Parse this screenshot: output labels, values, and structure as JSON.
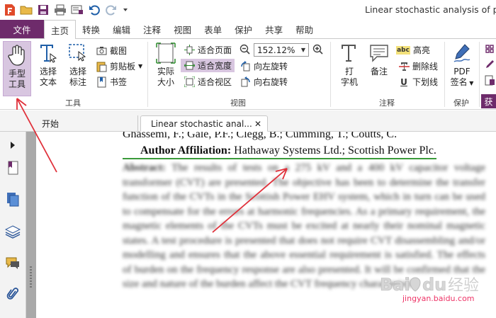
{
  "window": {
    "title": "Linear stochastic analysis of po"
  },
  "ribbon_tabs": [
    "文件",
    "主页",
    "转换",
    "编辑",
    "注释",
    "视图",
    "表单",
    "保护",
    "共享",
    "帮助"
  ],
  "ribbon": {
    "hand_tool": {
      "line1": "手型",
      "line2": "工具"
    },
    "select_text": {
      "line1": "选择",
      "line2": "文本"
    },
    "select_annot": {
      "line1": "选择",
      "line2": "标注"
    },
    "screenshot": "截图",
    "clipboard": "剪贴板",
    "bookmark": "书签",
    "group_tools": "工具",
    "actual_size": {
      "line1": "实际",
      "line2": "大小"
    },
    "fit_page": "适合页面",
    "fit_width": "适合宽度",
    "fit_visible": "适合视区",
    "zoom_value": "152.12%",
    "rotate_left": "向左旋转",
    "rotate_right": "向右旋转",
    "group_view": "视图",
    "typewriter": {
      "line1": "打",
      "line2": "字机"
    },
    "note": "备注",
    "highlight_badge": "abc",
    "highlight": "高亮",
    "strikeout": "删除线",
    "underline_badge": "U",
    "underline": "下划线",
    "group_comment": "注释",
    "pdf_sign": {
      "line1": "PDF",
      "line2": "签名"
    },
    "group_protect": "保护",
    "get_label": "获"
  },
  "doc_tabs": {
    "home": "开始",
    "doc": "Linear stochastic anal..."
  },
  "document": {
    "authors": "Ghassemi, F.; Gale, P.F.; Clegg, B.; Cumming, T.; Coutts, C.",
    "affil_label": "Author Affiliation:",
    "affil_value": " Hathaway Systems Ltd.; Scottish Power Plc.",
    "abstract_label": "Abstract:",
    "abstract_text": "The results of tests on a 275 kV and a 400 kV capacitor voltage transformer (CVT) are presented. The objective has been to determine the transfer function of the CVTs in the Scottish Power EHV system, which in turn can be used to compensate for the errors at harmonic frequencies. As a primary requirement, the magnetic elements of the CVTs must be excited at nearly their nominal magnetic states. A test procedure is presented that does not require CVT disassembling and/or modelling and ensures that the above essential requirement is satisfied. The effects of burden on the frequency response are also presented. It will be confirmed that the size and nature of the burden affect the CVT frequency characteristic."
  },
  "watermark": {
    "brand": "Bai",
    "brand2": "经验",
    "url": "jingyan.baidu.com"
  },
  "colors": {
    "accent": "#6e2b6b",
    "selection": "#d8c6e0",
    "arrow": "#e0303a",
    "underline": "#3a9a3a"
  }
}
